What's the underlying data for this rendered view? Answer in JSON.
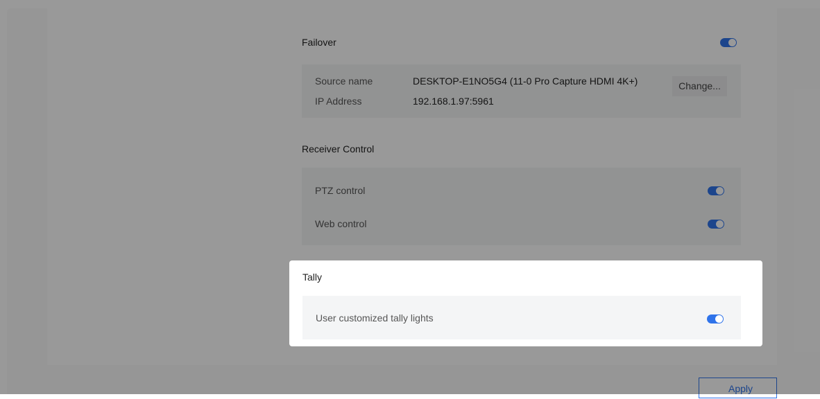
{
  "failover": {
    "title": "Failover",
    "enabled": true,
    "source_name_label": "Source name",
    "source_name_value": "DESKTOP-E1NO5G4 (11-0 Pro Capture HDMI 4K+)",
    "ip_label": "IP Address",
    "ip_value": "192.168.1.97:5961",
    "change_button": "Change..."
  },
  "receiver_control": {
    "title": "Receiver Control",
    "items": [
      {
        "label": "PTZ control",
        "enabled": true
      },
      {
        "label": "Web control",
        "enabled": true
      }
    ]
  },
  "tally": {
    "title": "Tally",
    "items": [
      {
        "label": "User customized tally lights",
        "enabled": true
      }
    ]
  },
  "footer": {
    "apply_button": "Apply"
  },
  "colors": {
    "accent": "#2f73ea",
    "overlay": "rgba(0,0,0,0.40)"
  }
}
